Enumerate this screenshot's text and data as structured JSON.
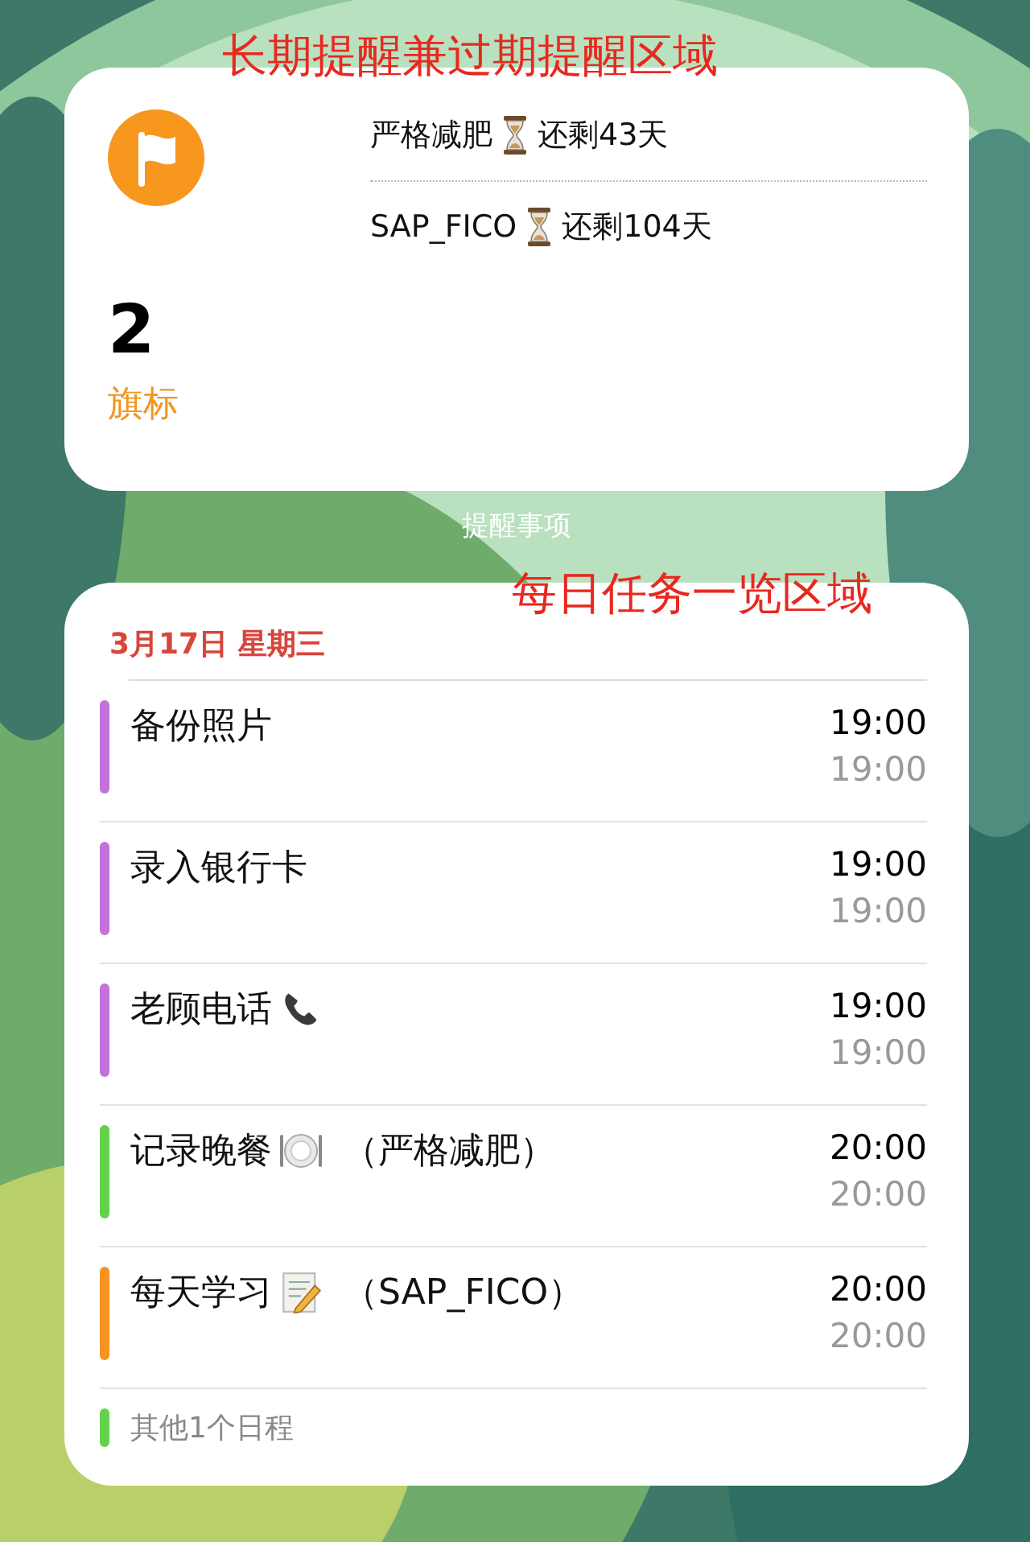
{
  "top_annotation": "长期提醒兼过期提醒区域",
  "flag_widget": {
    "count": "2",
    "label": "旗标",
    "items": [
      {
        "title": "严格减肥",
        "remaining": "还剩43天"
      },
      {
        "title": "SAP_FICO",
        "remaining": "还剩104天"
      }
    ]
  },
  "widget_caption": "提醒事项",
  "daily_annotation": "每日任务一览区域",
  "calendar": {
    "date": "3月17日 星期三",
    "events": [
      {
        "kind": "plain",
        "title": "备份照片",
        "color": "#c471d9",
        "start": "19:00",
        "end": "19:00"
      },
      {
        "kind": "plain",
        "title": "录入银行卡",
        "color": "#c471d9",
        "start": "19:00",
        "end": "19:00"
      },
      {
        "kind": "phone",
        "title": "老顾电话",
        "color": "#c471d9",
        "start": "19:00",
        "end": "19:00"
      },
      {
        "kind": "plate",
        "title": "记录晚餐",
        "note": "（严格减肥）",
        "color": "#62d24b",
        "start": "20:00",
        "end": "20:00"
      },
      {
        "kind": "memo",
        "title": "每天学习",
        "note": "（SAP_FICO）",
        "color": "#f7931e",
        "start": "20:00",
        "end": "20:00"
      }
    ],
    "more": {
      "text": "其他1个日程",
      "color": "#62d24b"
    }
  }
}
